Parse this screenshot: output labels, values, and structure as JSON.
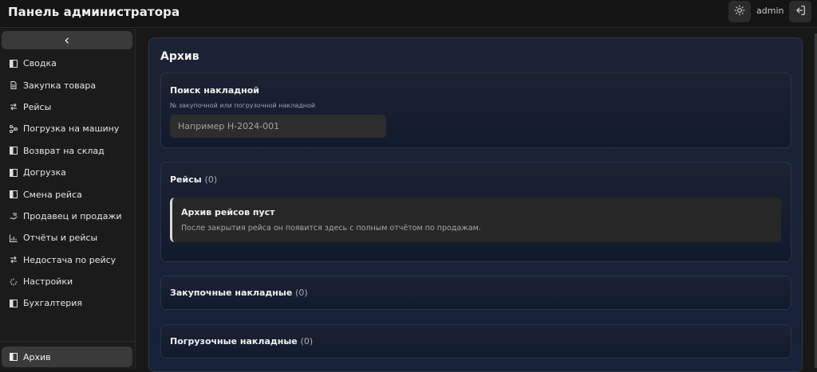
{
  "header": {
    "title": "Панель администратора",
    "user": "admin",
    "theme_icon": "sun-icon",
    "logout_icon": "logout-icon"
  },
  "sidebar": {
    "collapse_icon": "chevron-left-icon",
    "items": [
      {
        "label": "Сводка",
        "icon": "panel-icon"
      },
      {
        "label": "Закупка товара",
        "icon": "document-icon"
      },
      {
        "label": "Рейсы",
        "icon": "arrows-swap-icon"
      },
      {
        "label": "Погрузка на машину",
        "icon": "network-icon"
      },
      {
        "label": "Возврат на склад",
        "icon": "panel-icon"
      },
      {
        "label": "Догрузка",
        "icon": "panel-icon"
      },
      {
        "label": "Смена рейса",
        "icon": "panel-icon"
      },
      {
        "label": "Продавец и продажи",
        "icon": "hand-coins-icon"
      },
      {
        "label": "Отчёты и рейсы",
        "icon": "bar-chart-icon"
      },
      {
        "label": "Недостача по рейсу",
        "icon": "arrows-swap-icon"
      },
      {
        "label": "Настройки",
        "icon": "loader-icon"
      },
      {
        "label": "Бухгалтерия",
        "icon": "panel-icon"
      }
    ],
    "active": {
      "label": "Архив",
      "icon": "panel-icon"
    }
  },
  "main": {
    "title": "Архив",
    "search_card": {
      "title": "Поиск накладной",
      "field_label": "№ закупочной или погрузочной накладной",
      "placeholder": "Например Н-2024-001"
    },
    "trips_card": {
      "title": "Рейсы",
      "count": "(0)",
      "empty_title": "Архив рейсов пуст",
      "empty_text": "После закрытия рейса он появится здесь с полным отчётом по продажам."
    },
    "purchase_card": {
      "title": "Закупочные накладные",
      "count": "(0)"
    },
    "loading_card": {
      "title": "Погрузочные накладные",
      "count": "(0)"
    }
  }
}
